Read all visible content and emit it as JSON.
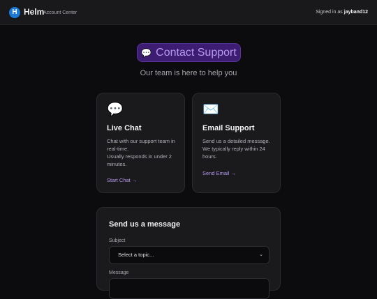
{
  "header": {
    "brand_letter": "H",
    "brand_name": "Helm",
    "brand_sub": "Account Center",
    "signed_in_prefix": "Signed in as",
    "username": "jayband12"
  },
  "page": {
    "title": "Contact Support",
    "subtitle": "Our team is here to help you"
  },
  "cards": {
    "chat": {
      "icon": "speech-bubble-icon",
      "title": "Live Chat",
      "desc_line1": "Chat with our support team in real-time.",
      "desc_line2": "Usually responds in under 2 minutes.",
      "link": "Start Chat →"
    },
    "email": {
      "icon": "envelope-icon",
      "title": "Email Support",
      "desc_line1": "Send us a detailed message. We typically reply within 24 hours.",
      "link": "Send Email →"
    }
  },
  "form": {
    "title": "Send us a message",
    "subject_label": "Subject",
    "subject_value": "Select a topic...",
    "message_label": "Message"
  },
  "colors": {
    "accent": "#b597f0",
    "pill_bg": "#3c1d72",
    "brand_blue": "#1d78d6"
  }
}
